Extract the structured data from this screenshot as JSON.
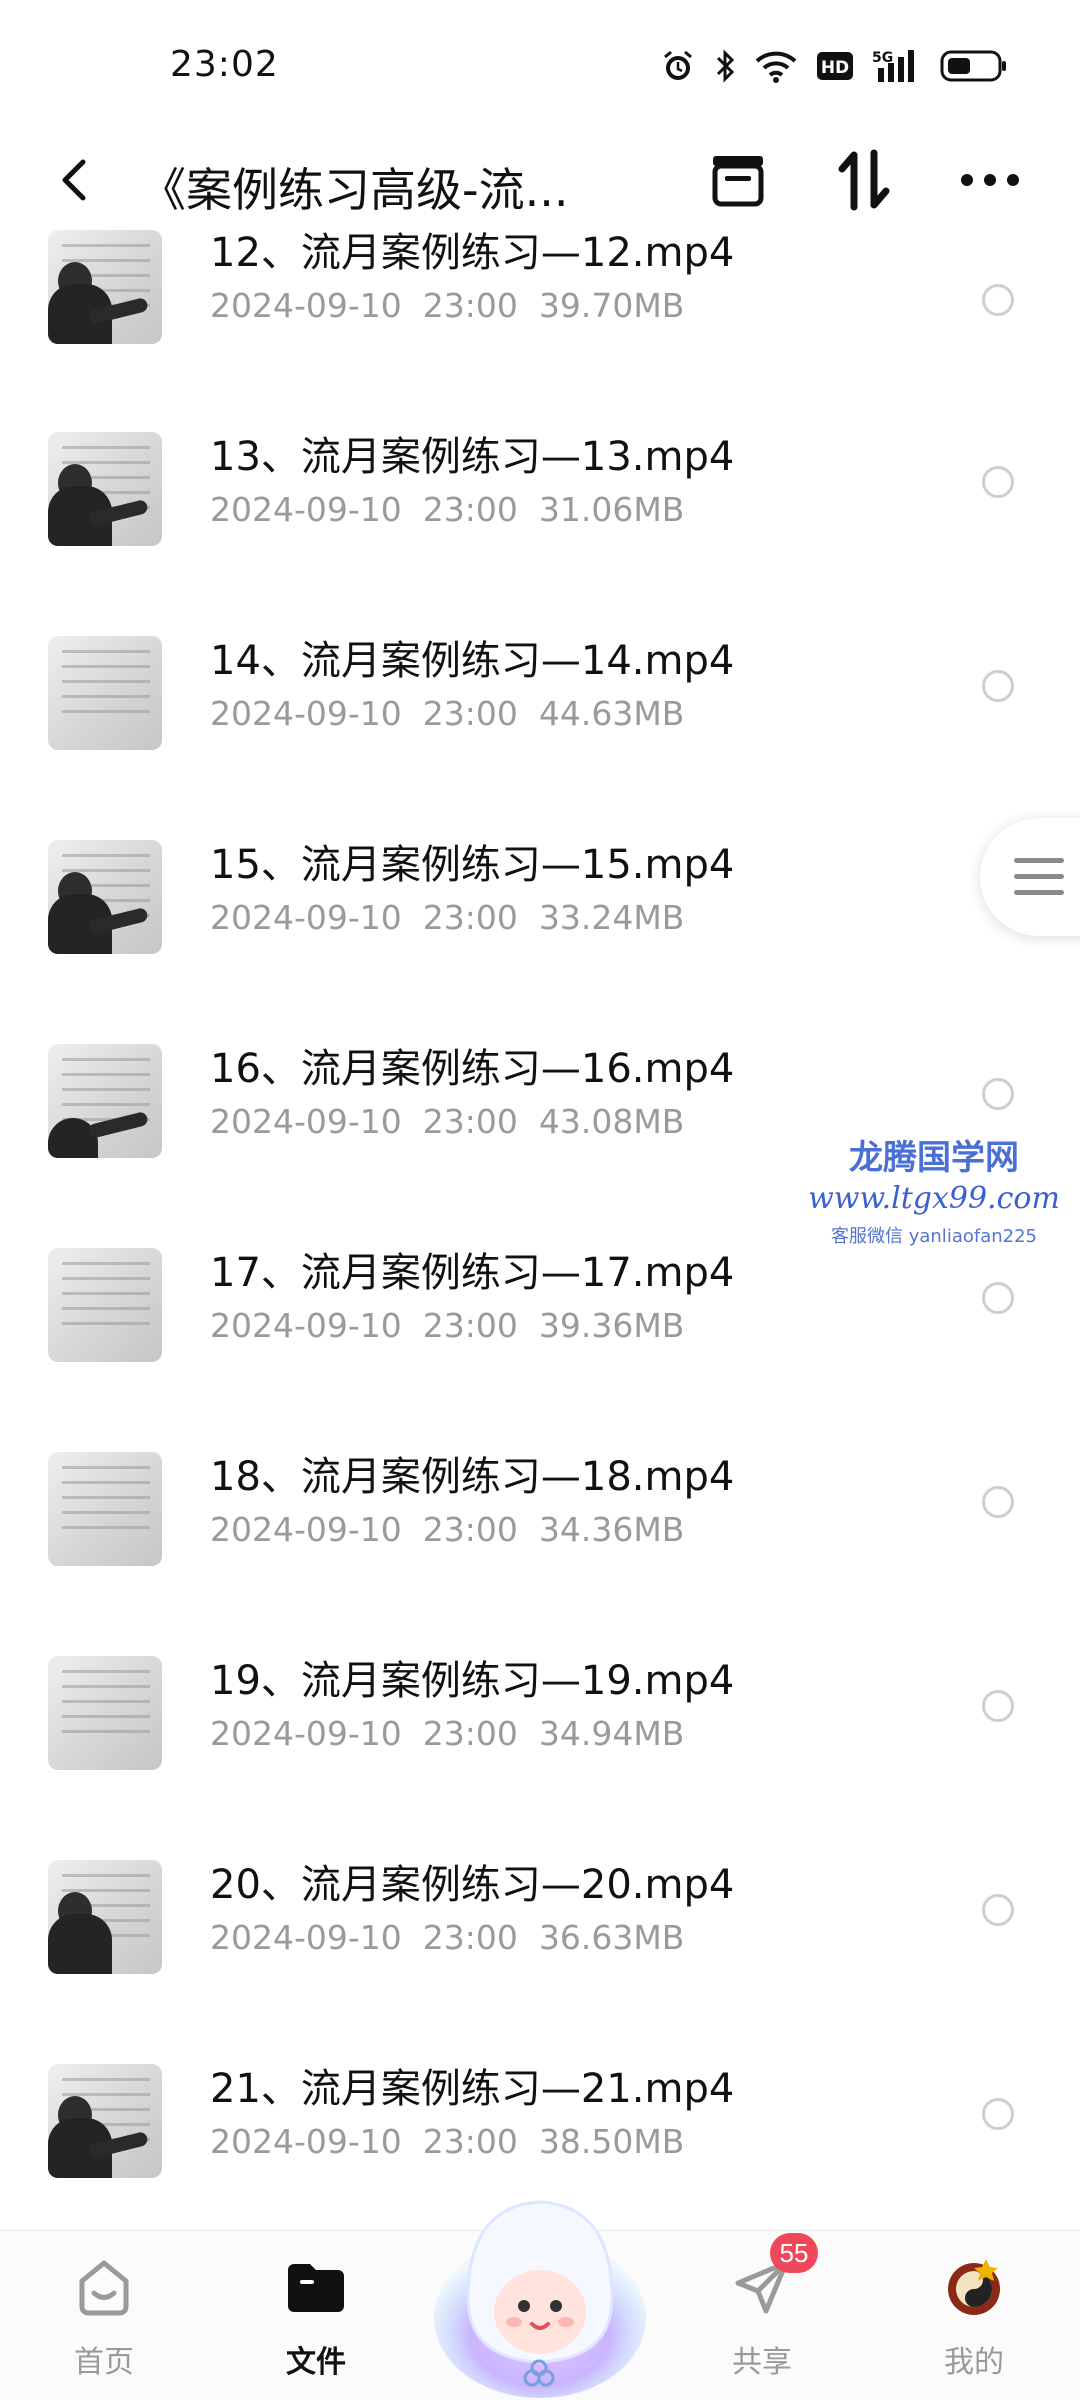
{
  "status_bar": {
    "time": "23:02",
    "icons": [
      "alarm-icon",
      "bluetooth-icon",
      "wifi-icon",
      "hd-icon",
      "signal-5g-icon",
      "battery-icon"
    ],
    "hd_label": "HD",
    "network_label": "5G"
  },
  "header": {
    "title": "《案例练习高级-流...",
    "icons": [
      "back-icon",
      "archive-icon",
      "sort-icon",
      "more-icon"
    ]
  },
  "files": [
    {
      "name": "12、流月案例练习—12.mp4",
      "date": "2024-09-10",
      "time": "23:00",
      "size": "39.70MB"
    },
    {
      "name": "13、流月案例练习—13.mp4",
      "date": "2024-09-10",
      "time": "23:00",
      "size": "31.06MB"
    },
    {
      "name": "14、流月案例练习—14.mp4",
      "date": "2024-09-10",
      "time": "23:00",
      "size": "44.63MB"
    },
    {
      "name": "15、流月案例练习—15.mp4",
      "date": "2024-09-10",
      "time": "23:00",
      "size": "33.24MB"
    },
    {
      "name": "16、流月案例练习—16.mp4",
      "date": "2024-09-10",
      "time": "23:00",
      "size": "43.08MB"
    },
    {
      "name": "17、流月案例练习—17.mp4",
      "date": "2024-09-10",
      "time": "23:00",
      "size": "39.36MB"
    },
    {
      "name": "18、流月案例练习—18.mp4",
      "date": "2024-09-10",
      "time": "23:00",
      "size": "34.36MB"
    },
    {
      "name": "19、流月案例练习—19.mp4",
      "date": "2024-09-10",
      "time": "23:00",
      "size": "34.94MB"
    },
    {
      "name": "20、流月案例练习—20.mp4",
      "date": "2024-09-10",
      "time": "23:00",
      "size": "36.63MB"
    },
    {
      "name": "21、流月案例练习—21.mp4",
      "date": "2024-09-10",
      "time": "23:00",
      "size": "38.50MB"
    }
  ],
  "watermark": {
    "title": "龙腾国学网",
    "url": "www.ltgx99.com",
    "contact": "客服微信 yanliaofan225"
  },
  "bottom_nav": {
    "items": [
      {
        "label": "首页",
        "icon": "home-icon",
        "active": false
      },
      {
        "label": "文件",
        "icon": "folder-icon",
        "active": true
      },
      {
        "label": "共享",
        "icon": "share-plane-icon",
        "active": false,
        "badge": "55"
      },
      {
        "label": "我的",
        "icon": "avatar-icon",
        "active": false
      }
    ]
  },
  "colors": {
    "meta_text": "#9a9a9a",
    "badge": "#f0485b",
    "watermark": "#3b5fd0"
  }
}
